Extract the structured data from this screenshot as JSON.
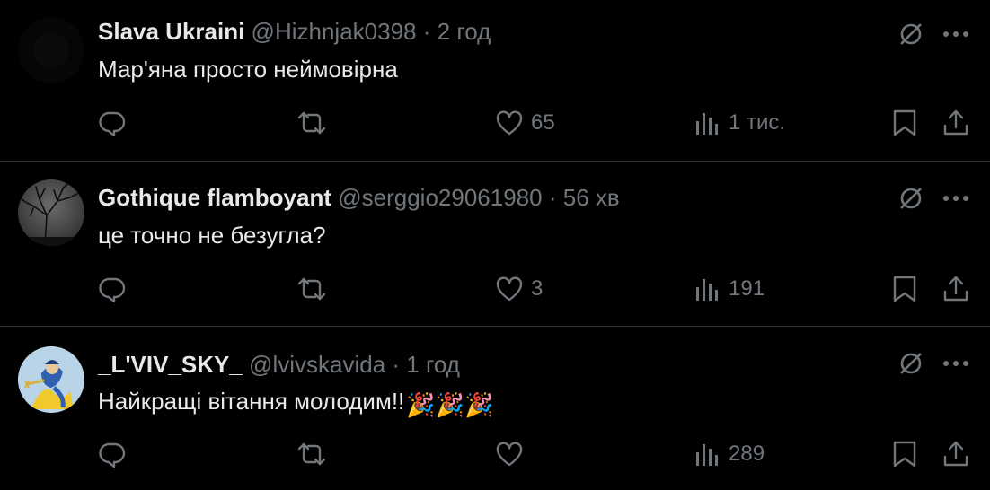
{
  "colors": {
    "background": "#000000",
    "primary_text": "#e7e9ea",
    "secondary_text": "#71767b",
    "divider": "#2f3336"
  },
  "posts": [
    {
      "name": "Slava Ukraini",
      "handle": "@Hizhnjak0398",
      "dot": "·",
      "time": "2 год",
      "text": "Мар'яна просто неймовірна",
      "emoji": "",
      "avatar": "dark-avatar",
      "replies": "",
      "reposts": "",
      "likes": "65",
      "views": "1 тис."
    },
    {
      "name": "Gothique flamboyant",
      "handle": "@serggio29061980",
      "dot": "·",
      "time": "56 хв",
      "text": "це точно не безугла?",
      "emoji": "",
      "avatar": "bare-tree-avatar",
      "replies": "",
      "reposts": "",
      "likes": "3",
      "views": "191"
    },
    {
      "name": "_L'VIV_SKY_",
      "handle": "@lvivskavida",
      "dot": "·",
      "time": "1 год",
      "text": "Найкращі вітання молодим!!",
      "emoji": "🎉🎉🎉",
      "avatar": "lion-emblem-avatar",
      "replies": "",
      "reposts": "",
      "likes": "",
      "views": "289"
    }
  ],
  "icons": {
    "grok": "grok-icon",
    "more": "more-icon",
    "reply": "reply-icon",
    "repost": "repost-icon",
    "like": "like-icon",
    "views": "views-icon",
    "bookmark": "bookmark-icon",
    "share": "share-icon"
  }
}
